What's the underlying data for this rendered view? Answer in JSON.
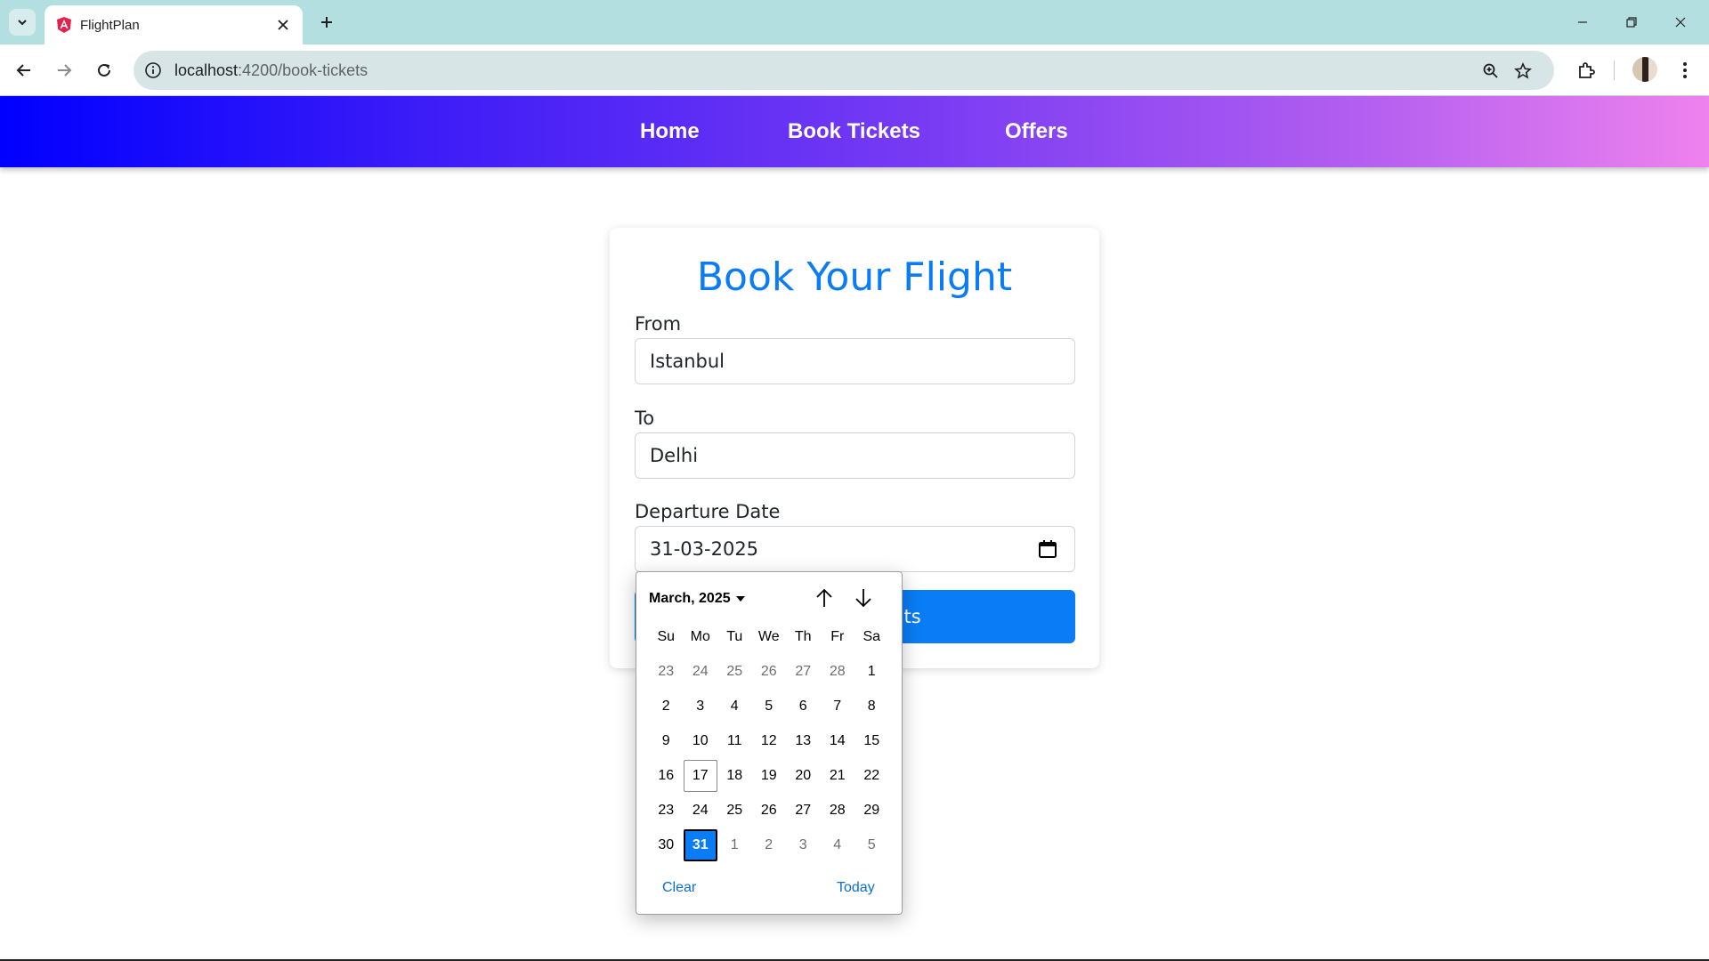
{
  "browser": {
    "tab_title": "FlightPlan",
    "url_host": "localhost",
    "url_path": ":4200/book-tickets"
  },
  "nav": {
    "links": [
      "Home",
      "Book Tickets",
      "Offers"
    ]
  },
  "form": {
    "title": "Book Your Flight",
    "from_label": "From",
    "from_value": "Istanbul",
    "to_label": "To",
    "to_value": "Delhi",
    "date_label": "Departure Date",
    "date_value": "31-03-2025",
    "submit_label": "Search Flights"
  },
  "datepicker": {
    "month_label": "March, 2025",
    "weekdays": [
      "Su",
      "Mo",
      "Tu",
      "We",
      "Th",
      "Fr",
      "Sa"
    ],
    "weeks": [
      [
        "23",
        "24",
        "25",
        "26",
        "27",
        "28",
        "1"
      ],
      [
        "2",
        "3",
        "4",
        "5",
        "6",
        "7",
        "8"
      ],
      [
        "9",
        "10",
        "11",
        "12",
        "13",
        "14",
        "15"
      ],
      [
        "16",
        "17",
        "18",
        "19",
        "20",
        "21",
        "22"
      ],
      [
        "23",
        "24",
        "25",
        "26",
        "27",
        "28",
        "29"
      ],
      [
        "30",
        "31",
        "1",
        "2",
        "3",
        "4",
        "5"
      ]
    ],
    "today": "17",
    "selected": "31",
    "clear_label": "Clear",
    "today_label": "Today"
  },
  "colors": {
    "accent": "#0a7cf5",
    "nav_gradient_start": "#0000ff",
    "nav_gradient_end": "#ee82ee"
  }
}
